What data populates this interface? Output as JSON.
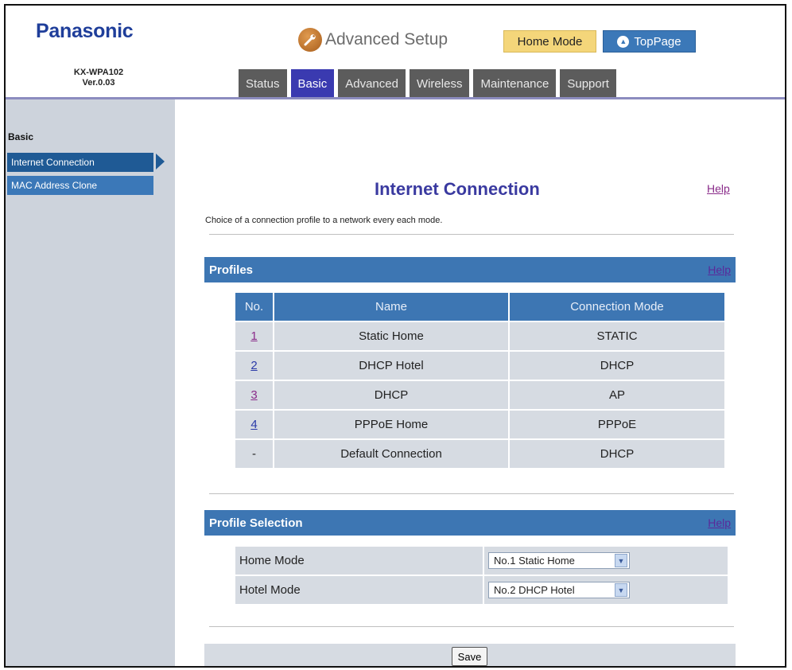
{
  "header": {
    "brand": "Panasonic",
    "model_line1": "KX-WPA102",
    "model_line2": "Ver.0.03",
    "setup_title": "Advanced Setup",
    "setup_icon": "wrench-icon",
    "mode_badge": "Home Mode",
    "top_page_label": "TopPage"
  },
  "tabs": [
    {
      "label": "Status",
      "active": false
    },
    {
      "label": "Basic",
      "active": true
    },
    {
      "label": "Advanced",
      "active": false
    },
    {
      "label": "Wireless",
      "active": false
    },
    {
      "label": "Maintenance",
      "active": false
    },
    {
      "label": "Support",
      "active": false
    }
  ],
  "sidebar": {
    "heading": "Basic",
    "items": [
      {
        "label": "Internet Connection",
        "active": true
      },
      {
        "label": "MAC Address Clone",
        "active": false
      }
    ]
  },
  "main": {
    "title": "Internet Connection",
    "help": "Help",
    "description": "Choice of a connection profile to a network every each mode."
  },
  "profiles": {
    "title": "Profiles",
    "help": "Help",
    "columns": [
      "No.",
      "Name",
      "Connection Mode"
    ],
    "rows": [
      {
        "no": "1",
        "name": "Static Home",
        "mode": "STATIC"
      },
      {
        "no": "2",
        "name": "DHCP Hotel",
        "mode": "DHCP"
      },
      {
        "no": "3",
        "name": "DHCP",
        "mode": "AP"
      },
      {
        "no": "4",
        "name": "PPPoE Home",
        "mode": "PPPoE"
      },
      {
        "no": "-",
        "name": "Default Connection",
        "mode": "DHCP"
      }
    ]
  },
  "profile_selection": {
    "title": "Profile Selection",
    "help": "Help",
    "home_label": "Home Mode",
    "home_value": "No.1 Static Home",
    "hotel_label": "Hotel Mode",
    "hotel_value": "No.2 DHCP Hotel"
  },
  "actions": {
    "save_label": "Save"
  },
  "colors": {
    "accent": "#3d76b3",
    "tab_active": "#3a3ab0",
    "brand": "#1f3e9a",
    "badge": "#f4d67a"
  }
}
